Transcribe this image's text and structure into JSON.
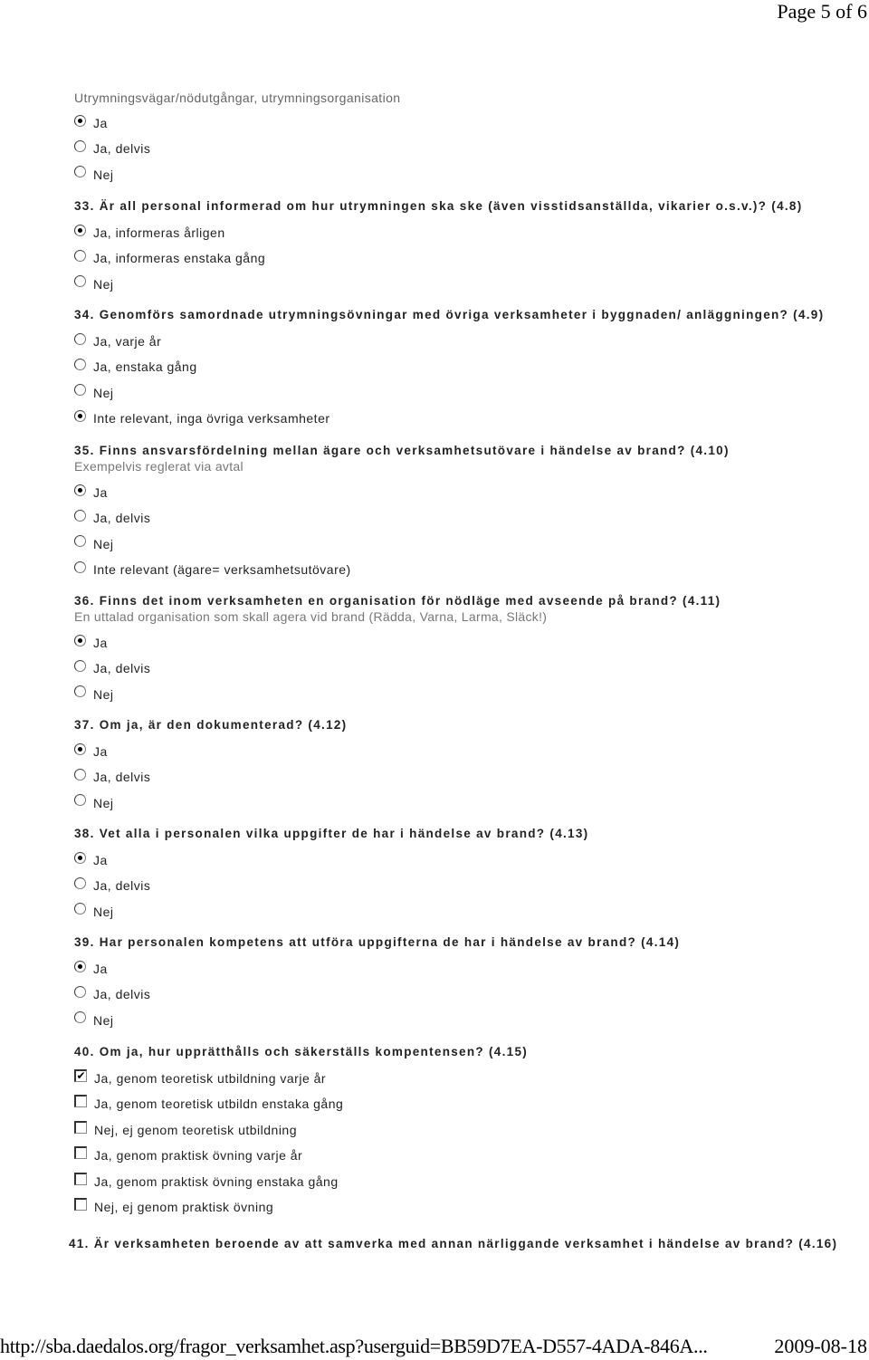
{
  "page": {
    "header": "Page 5 of 6",
    "footer_url": "http://sba.daedalos.org/fragor_verksamhet.asp?userguid=BB59D7EA-D557-4ADA-846A...",
    "footer_date": "2009-08-18"
  },
  "section": {
    "title": "Utrymningsvägar/nödutgångar, utrymningsorganisation",
    "options": [
      {
        "label": "Ja",
        "checked": true
      },
      {
        "label": "Ja, delvis",
        "checked": false
      },
      {
        "label": "Nej",
        "checked": false
      }
    ]
  },
  "questions": [
    {
      "text": "33. Är all personal informerad om hur utrymningen ska ske (även visstidsanställda, vikarier o.s.v.)? (4.8)",
      "options": [
        {
          "label": "Ja, informeras årligen",
          "checked": true
        },
        {
          "label": "Ja, informeras enstaka gång",
          "checked": false
        },
        {
          "label": "Nej",
          "checked": false
        }
      ]
    },
    {
      "text": "34. Genomförs samordnade utrymningsövningar med övriga verksamheter i byggnaden/ anläggningen? (4.9)",
      "options": [
        {
          "label": "Ja, varje år",
          "checked": false
        },
        {
          "label": "Ja, enstaka gång",
          "checked": false
        },
        {
          "label": "Nej",
          "checked": false
        },
        {
          "label": "Inte relevant, inga övriga verksamheter",
          "checked": true
        }
      ]
    },
    {
      "text": "35. Finns ansvarsfördelning mellan ägare och verksamhetsutövare i händelse av brand? (4.10)",
      "hint": "Exempelvis reglerat via avtal",
      "options": [
        {
          "label": "Ja",
          "checked": true
        },
        {
          "label": "Ja, delvis",
          "checked": false
        },
        {
          "label": "Nej",
          "checked": false
        },
        {
          "label": "Inte relevant (ägare= verksamhetsutövare)",
          "checked": false
        }
      ]
    },
    {
      "text": "36. Finns det inom verksamheten en organisation för nödläge med avseende på brand? (4.11)",
      "hint": "En uttalad organisation som skall agera vid brand (Rädda, Varna, Larma, Släck!)",
      "options": [
        {
          "label": "Ja",
          "checked": true
        },
        {
          "label": "Ja, delvis",
          "checked": false
        },
        {
          "label": "Nej",
          "checked": false
        }
      ]
    },
    {
      "text": "37. Om ja, är den dokumenterad? (4.12)",
      "options": [
        {
          "label": "Ja",
          "checked": true
        },
        {
          "label": "Ja, delvis",
          "checked": false
        },
        {
          "label": "Nej",
          "checked": false
        }
      ]
    },
    {
      "text": "38. Vet alla i personalen vilka uppgifter de har i händelse av brand? (4.13)",
      "options": [
        {
          "label": "Ja",
          "checked": true
        },
        {
          "label": "Ja, delvis",
          "checked": false
        },
        {
          "label": "Nej",
          "checked": false
        }
      ]
    },
    {
      "text": "39. Har personalen kompetens att utföra uppgifterna de har i händelse av brand? (4.14)",
      "options": [
        {
          "label": "Ja",
          "checked": true
        },
        {
          "label": "Ja, delvis",
          "checked": false
        },
        {
          "label": "Nej",
          "checked": false
        }
      ]
    },
    {
      "text": "40. Om ja, hur upprätthålls och säkerställs kompentensen? (4.15)",
      "checkboxes": [
        {
          "label": "Ja, genom teoretisk utbildning varje år",
          "checked": true
        },
        {
          "label": "Ja, genom teoretisk utbildn enstaka gång",
          "checked": false
        },
        {
          "label": "Nej, ej genom teoretisk utbildning",
          "checked": false
        },
        {
          "label": "Ja, genom praktisk övning varje år",
          "checked": false
        },
        {
          "label": "Ja, genom praktisk övning enstaka gång",
          "checked": false
        },
        {
          "label": "Nej, ej genom praktisk övning",
          "checked": false
        }
      ]
    },
    {
      "text": "41. Är verksamheten beroende av att samverka med annan närliggande verksamhet i händelse av brand? (4.16)"
    }
  ]
}
